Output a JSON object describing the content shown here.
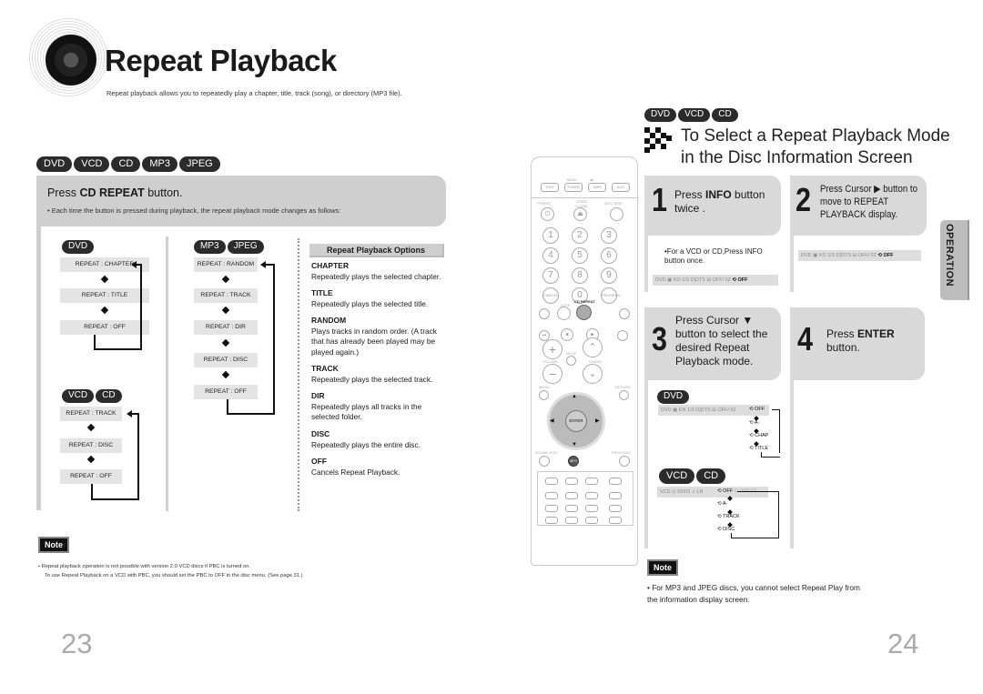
{
  "page_left": {
    "title": "Repeat Playback",
    "subtitle": "Repeat playback allows you to repeatedly play a chapter, title, track (song), or directory (MP3 file).",
    "disc_badges": [
      "DVD",
      "VCD",
      "CD",
      "MP3",
      "JPEG"
    ],
    "instruction": {
      "prefix": "Press ",
      "bold": "CD REPEAT",
      "suffix": " button."
    },
    "instruction_note": "• Each time the button is pressed during playback, the repeat playback mode changes as follows:",
    "dvd": {
      "badges": [
        "DVD"
      ],
      "chain": [
        "REPEAT : CHAPTER",
        "REPEAT : TITLE",
        "REPEAT : OFF"
      ]
    },
    "vcd_cd": {
      "badges": [
        "VCD",
        "CD"
      ],
      "chain": [
        "REPEAT : TRACK",
        "REPEAT : DISC",
        "REPEAT : OFF"
      ]
    },
    "mp3_jpeg": {
      "badges": [
        "MP3",
        "JPEG"
      ],
      "chain": [
        "REPEAT : RANDOM",
        "REPEAT : TRACK",
        "REPEAT : DIR",
        "REPEAT : DISC",
        "REPEAT : OFF"
      ]
    },
    "options": {
      "heading": "Repeat Playback Options",
      "items": [
        {
          "name": "CHAPTER",
          "desc": "Repeatedly plays the selected chapter."
        },
        {
          "name": "TITLE",
          "desc": "Repeatedly plays the selected title."
        },
        {
          "name": "RANDOM",
          "desc": "Plays tracks in random order. (A track that has already been played may be played again.)"
        },
        {
          "name": "TRACK",
          "desc": "Repeatedly plays the selected track."
        },
        {
          "name": "DIR",
          "desc": "Repeatedly plays all tracks in the selected folder."
        },
        {
          "name": "DISC",
          "desc": "Repeatedly plays the entire disc."
        },
        {
          "name": "OFF",
          "desc": "Cancels Repeat Playback."
        }
      ]
    },
    "note": {
      "label": "Note",
      "line1": "Repeat playback operation is not possible with version 2.0 VCD discs if PBC is turned on.",
      "line2": "To use Repeat Playback on a VCD with PBC, you should set the PBC to OFF in the disc menu. (See page 31.)"
    },
    "page_number": "23"
  },
  "remote": {
    "source_labels": [
      "DVD",
      "TUNER",
      "TAPE",
      "AUX"
    ],
    "source_sublabels": [
      "BAND",
      "◂▸"
    ],
    "power_label": "POWER",
    "open_close_label": "OPEN/ CLOSE",
    "disc_skip_label": "DISC SKIP",
    "digits": [
      "1",
      "2",
      "3",
      "4",
      "5",
      "6",
      "7",
      "8",
      "9",
      "0"
    ],
    "cancel_label": "CANCEL",
    "program_label": "PROGRAM",
    "step_label": "STEP",
    "cd_repeat_label": "CD REPEAT",
    "mute_label": "MUTE",
    "volume_label": "VOLUME",
    "tuning_label": "TUNING",
    "menu_label": "MENU",
    "return_label": "RETURN",
    "enter_label": "ENTER",
    "info_label": "INFO",
    "sound_edit_label": "SOUND EDIT",
    "mode_label": "PROLOGIC"
  },
  "page_right": {
    "disc_badges": [
      "DVD",
      "VCD",
      "CD"
    ],
    "title_line1": "To Select a Repeat Playback Mode",
    "title_line2": "in the Disc Information Screen",
    "steps": [
      {
        "num": "1",
        "prefix": "Press ",
        "bold": "INFO",
        "suffix": " button twice ."
      },
      {
        "num": "2",
        "text": "Press Cursor ▶ button to move to REPEAT PLAYBACK display."
      },
      {
        "num": "3",
        "text": "Press Cursor ▼ button to select the desired Repeat Playback mode."
      },
      {
        "num": "4",
        "prefix": "Press ",
        "bold": "ENTER",
        "suffix": " button."
      }
    ],
    "step1_note": "•For a VCD or CD,Press INFO button once.",
    "info_bar_dvd": {
      "disc": "DVD",
      "audio": "KO 1/3",
      "audio_fmt": "D|DTS",
      "subtitle": "OFF/ 02",
      "repeat": "OFF"
    },
    "step3_dvd": {
      "badge": "DVD",
      "bar": {
        "disc": "DVD",
        "audio": "EN 1/3",
        "audio_fmt": "D|DTS",
        "subtitle": "OFF/ 02"
      },
      "cycle": [
        "OFF",
        "A-",
        "CHAP",
        "TITLE"
      ]
    },
    "step3_vcd": {
      "badges": [
        "VCD",
        "CD"
      ],
      "bar": {
        "disc": "VCD",
        "track": "02/02",
        "audio": "LR",
        "time": "0:00:15"
      },
      "cycle": [
        "OFF",
        "A-",
        "TRACK",
        "DISC"
      ]
    },
    "side_tab": "OPERATION",
    "note": {
      "label": "Note",
      "text": "For MP3 and JPEG discs, you cannot select Repeat Play from the information display screen."
    },
    "page_number": "24"
  }
}
